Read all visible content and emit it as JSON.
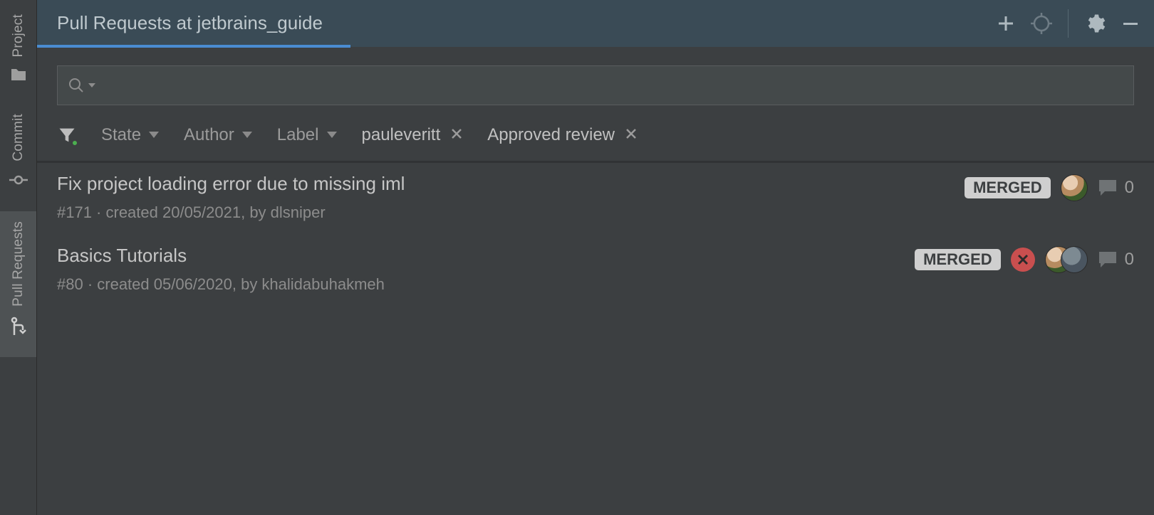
{
  "sidebar": {
    "items": [
      {
        "label": "Project"
      },
      {
        "label": "Commit"
      },
      {
        "label": "Pull Requests"
      }
    ]
  },
  "header": {
    "title": "Pull Requests at jetbrains_guide"
  },
  "search": {
    "placeholder": ""
  },
  "filters": {
    "dropdowns": [
      {
        "label": "State"
      },
      {
        "label": "Author"
      },
      {
        "label": "Label"
      }
    ],
    "chips": [
      {
        "label": "pauleveritt"
      },
      {
        "label": "Approved review"
      }
    ]
  },
  "pulls": [
    {
      "title": "Fix project loading error due to missing iml",
      "meta": "#171 · created 20/05/2021, by dlsniper",
      "status": "MERGED",
      "build_failed": false,
      "multi_avatar": false,
      "comments": "0"
    },
    {
      "title": "Basics Tutorials",
      "meta": "#80 · created 05/06/2020, by khalidabuhakmeh",
      "status": "MERGED",
      "build_failed": true,
      "multi_avatar": true,
      "comments": "0"
    }
  ]
}
